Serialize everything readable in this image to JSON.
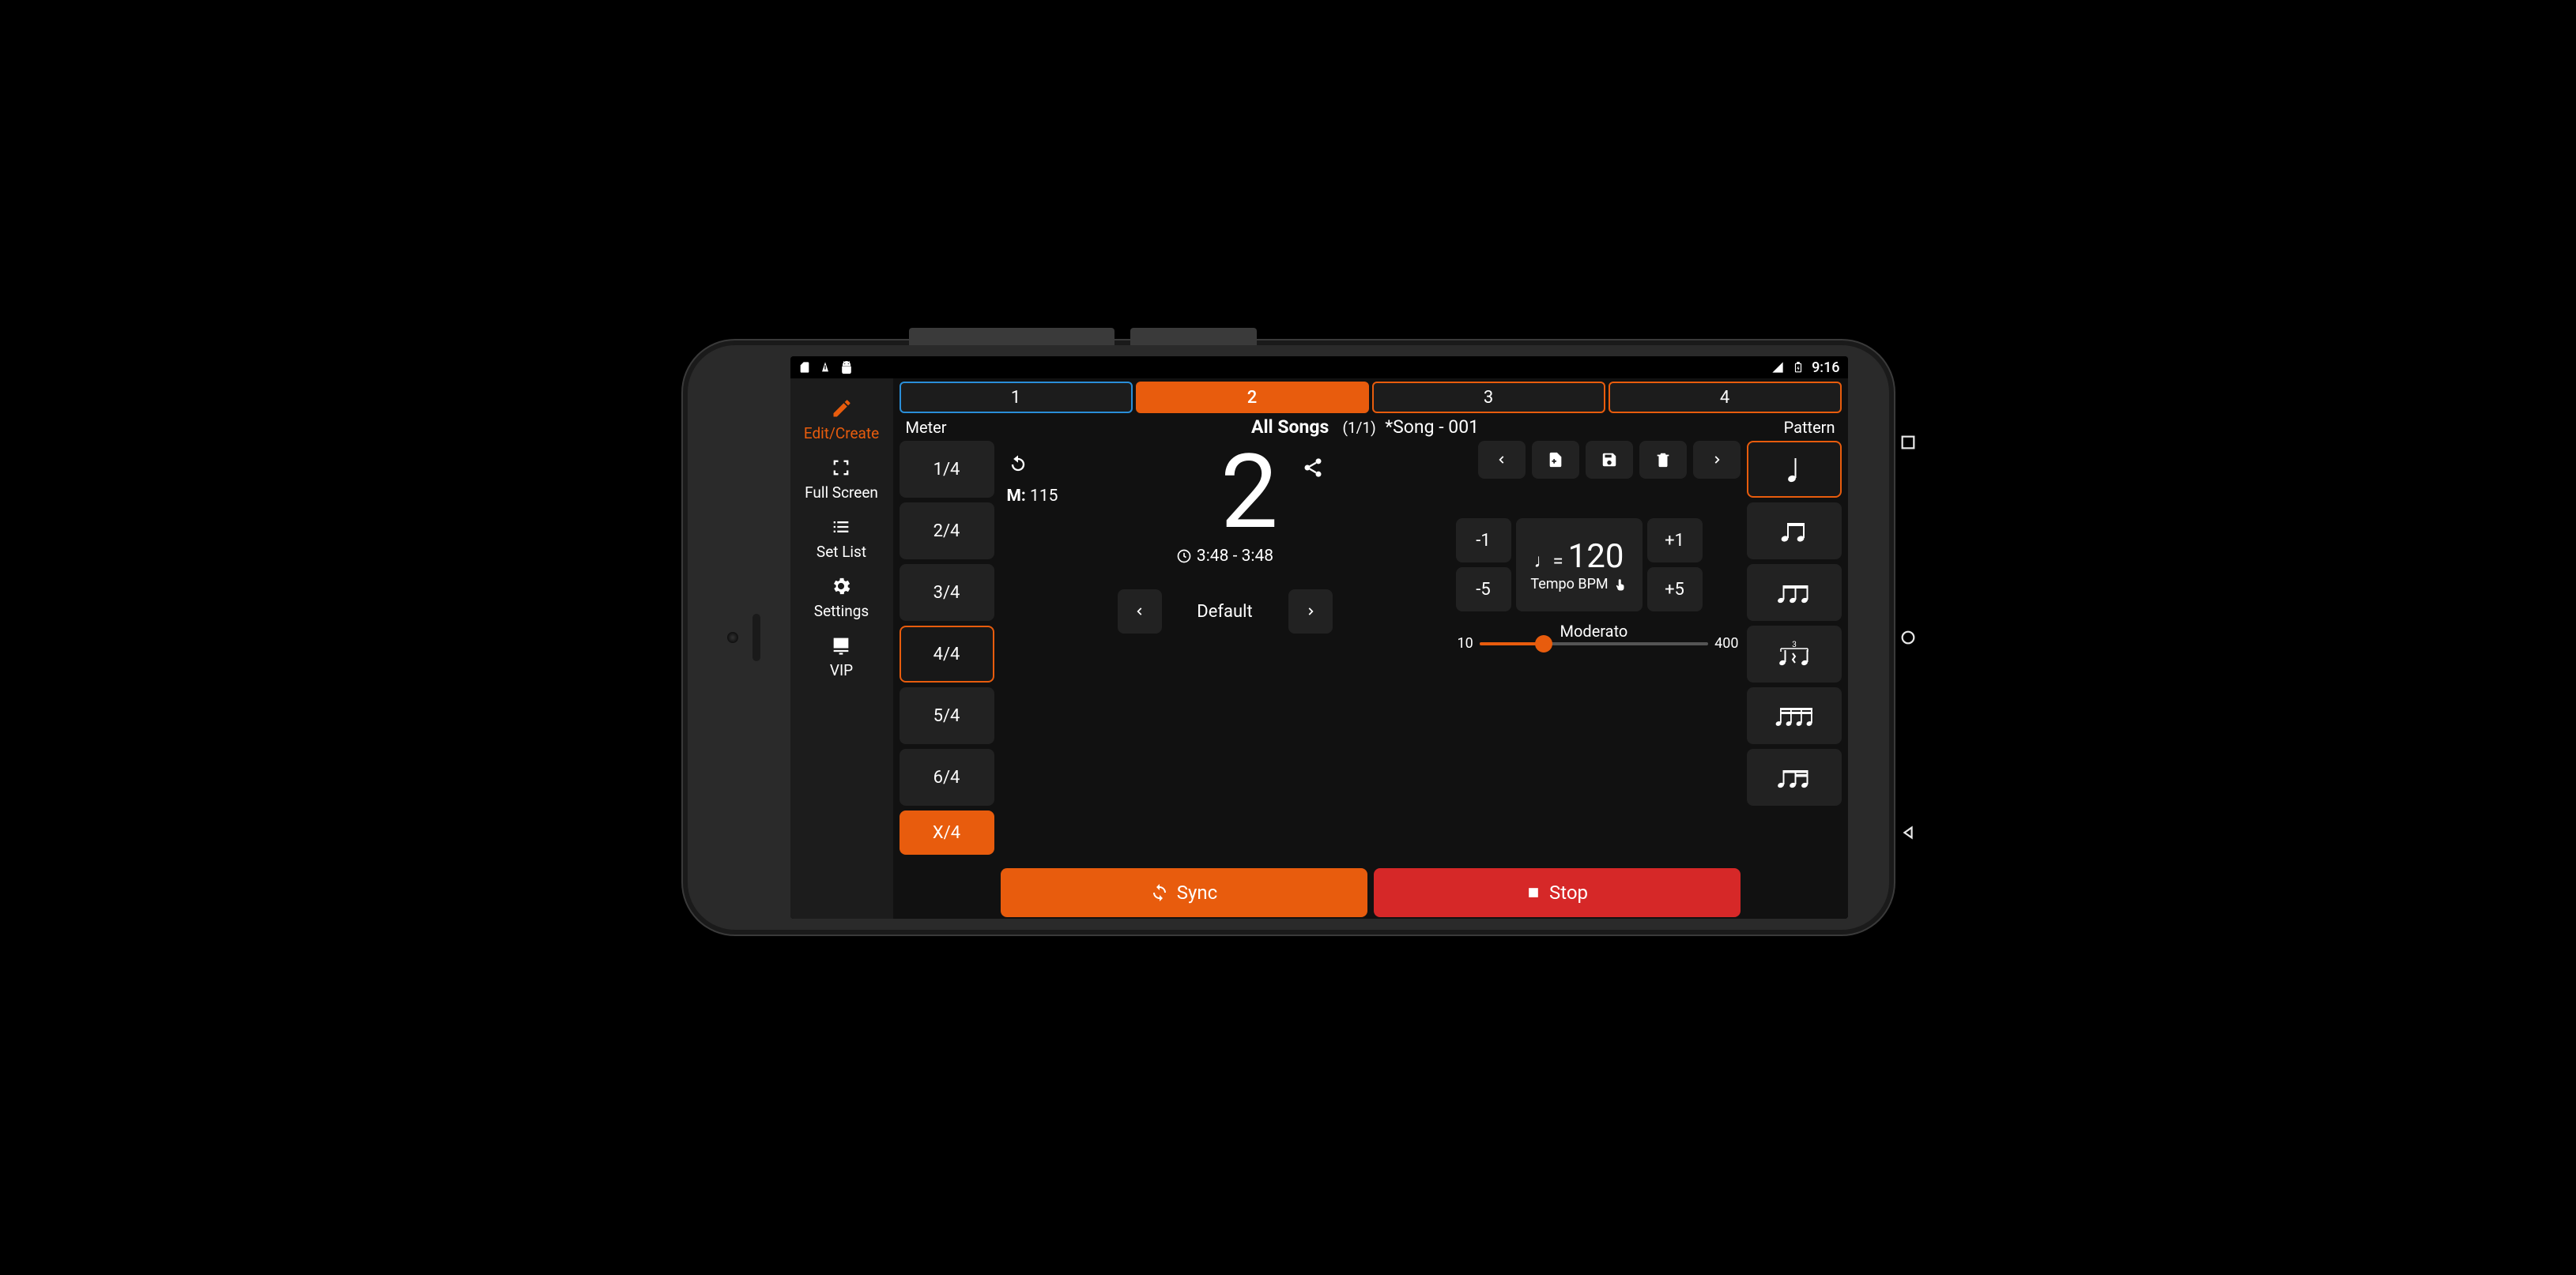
{
  "status_bar": {
    "time": "9:16"
  },
  "sidebar": {
    "items": [
      {
        "label": "Edit/Create",
        "icon": "pencil-icon",
        "active": true
      },
      {
        "label": "Full Screen",
        "icon": "fullscreen-icon"
      },
      {
        "label": "Set List",
        "icon": "list-icon"
      },
      {
        "label": "Settings",
        "icon": "gear-icon"
      },
      {
        "label": "VIP",
        "icon": "monitor-icon"
      }
    ]
  },
  "beats": {
    "values": [
      "1",
      "2",
      "3",
      "4"
    ],
    "active_index": 1,
    "selected_index": 0
  },
  "labels": {
    "meter": "Meter",
    "pattern": "Pattern"
  },
  "song": {
    "playlist": "All Songs",
    "counter": "(1/1)",
    "name": "*Song - 001"
  },
  "meter": {
    "options": [
      "1/4",
      "2/4",
      "3/4",
      "4/4",
      "5/4",
      "6/4"
    ],
    "selected_index": 3,
    "custom_label": "X/4"
  },
  "display": {
    "current_beat": "2",
    "measure_prefix": "M:",
    "measure": "115",
    "time_range": "3:48 - 3:48"
  },
  "set": {
    "name": "Default"
  },
  "tempo": {
    "dec1": "-1",
    "inc1": "+1",
    "dec5": "-5",
    "inc5": "+5",
    "bpm": "120",
    "bpm_prefix": "♩=",
    "label": "Tempo BPM",
    "min": "10",
    "max": "400",
    "marking": "Moderato"
  },
  "pattern": {
    "icons": [
      "quarter-note",
      "eighth-pair",
      "eighth-triplet",
      "triplet-rest",
      "sixteenth-four",
      "eighth-pair-2"
    ],
    "selected_index": 0
  },
  "buttons": {
    "sync": "Sync",
    "stop": "Stop"
  },
  "colors": {
    "accent": "#e85c0d",
    "danger": "#d62828",
    "blue": "#2a8ed8"
  }
}
